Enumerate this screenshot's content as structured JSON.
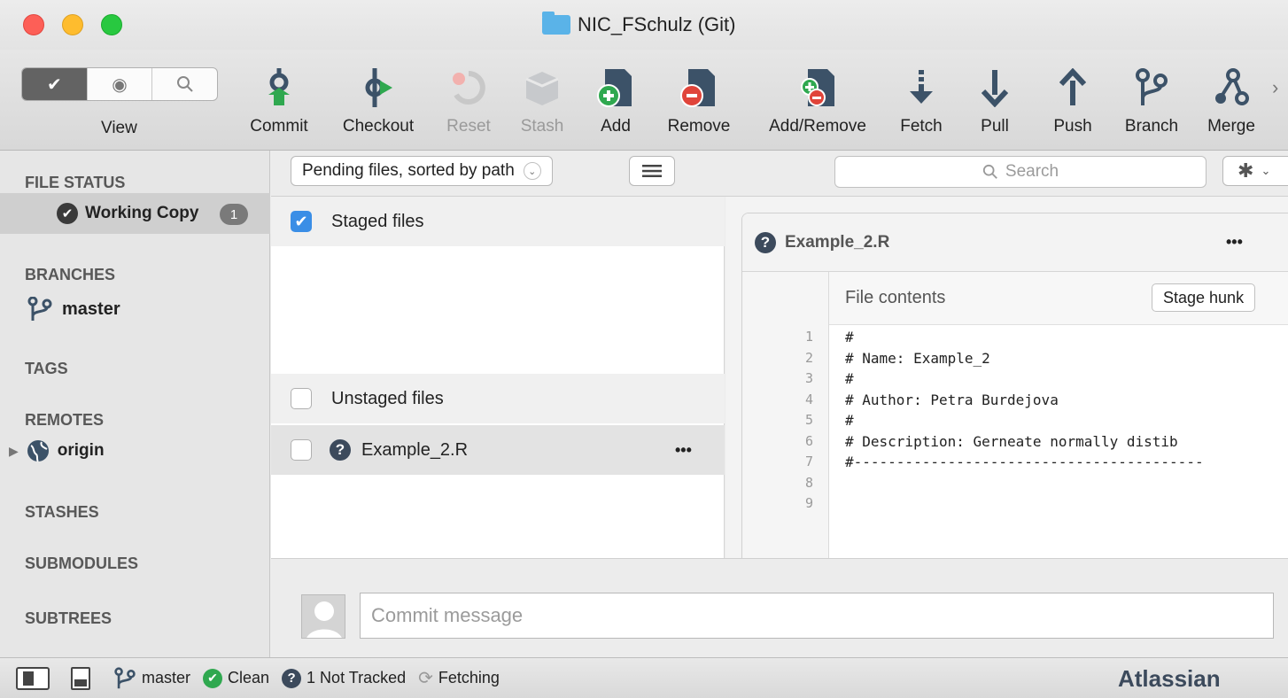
{
  "window": {
    "title": "NIC_FSchulz (Git)"
  },
  "toolbar": {
    "view_label": "View",
    "buttons": [
      {
        "label": "Commit"
      },
      {
        "label": "Checkout"
      },
      {
        "label": "Reset"
      },
      {
        "label": "Stash"
      },
      {
        "label": "Add"
      },
      {
        "label": "Remove"
      },
      {
        "label": "Add/Remove"
      },
      {
        "label": "Fetch"
      },
      {
        "label": "Pull"
      },
      {
        "label": "Push"
      },
      {
        "label": "Branch"
      },
      {
        "label": "Merge"
      }
    ],
    "overflow": "›"
  },
  "sidebar": {
    "file_status": "FILE STATUS",
    "working_copy": "Working Copy",
    "working_copy_count": "1",
    "branches": "BRANCHES",
    "branch_master": "master",
    "tags": "TAGS",
    "remotes": "REMOTES",
    "remote_origin": "origin",
    "stashes": "STASHES",
    "submodules": "SUBMODULES",
    "subtrees": "SUBTREES"
  },
  "filter": {
    "sort_label": "Pending files, sorted by path",
    "search_placeholder": "Search"
  },
  "files": {
    "staged_header": "Staged files",
    "unstaged_header": "Unstaged files",
    "unstaged": [
      {
        "name": "Example_2.R",
        "more": "•••"
      }
    ]
  },
  "diff": {
    "filename": "Example_2.R",
    "more": "•••",
    "hunk_title": "File contents",
    "stage_hunk": "Stage hunk",
    "lines": [
      {
        "n": "1",
        "text": "#"
      },
      {
        "n": "2",
        "text": "# Name: Example_2"
      },
      {
        "n": "3",
        "text": "#"
      },
      {
        "n": "4",
        "text": "# Author: Petra Burdejova"
      },
      {
        "n": "5",
        "text": "#"
      },
      {
        "n": "6",
        "text": "# Description: Gerneate normally distib"
      },
      {
        "n": "7",
        "text": "#-----------------------------------------"
      },
      {
        "n": "8",
        "text": ""
      },
      {
        "n": "9",
        "text": ""
      }
    ]
  },
  "commit": {
    "placeholder": "Commit message"
  },
  "statusbar": {
    "branch": "master",
    "clean": "Clean",
    "not_tracked": "1 Not Tracked",
    "fetching": "Fetching",
    "brand": "Atlassian"
  },
  "colors": {
    "accent": "#3a8ee6",
    "add_green": "#2fa84f",
    "remove_red": "#e0443a",
    "toolbar_dark": "#3c5268"
  }
}
